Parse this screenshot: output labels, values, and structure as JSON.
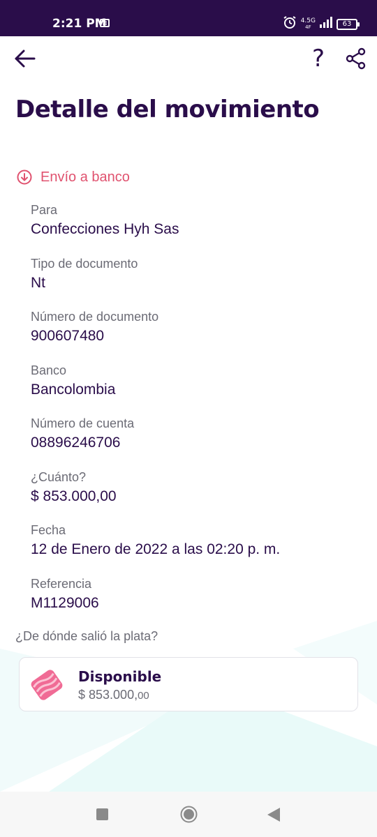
{
  "status_bar": {
    "time": "2:21 PM",
    "network_top": "4.5G",
    "network_bottom": "4F",
    "battery": "63"
  },
  "header": {
    "help_label": "?",
    "title": "Detalle del movimiento"
  },
  "movement": {
    "type": "Envío a banco",
    "fields": [
      {
        "label": "Para",
        "value": "Confecciones Hyh Sas"
      },
      {
        "label": "Tipo de documento",
        "value": "Nt"
      },
      {
        "label": "Número de documento",
        "value": "900607480"
      },
      {
        "label": "Banco",
        "value": "Bancolombia"
      },
      {
        "label": "Número de cuenta",
        "value": "08896246706"
      },
      {
        "label": "¿Cuánto?",
        "value": "$ 853.000,00"
      },
      {
        "label": "Fecha",
        "value": "12 de Enero de 2022 a las 02:20 p. m."
      },
      {
        "label": "Referencia",
        "value": "M1129006"
      }
    ]
  },
  "source": {
    "question": "¿De dónde salió la plata?",
    "account_name": "Disponible",
    "amount_main": "$ 853.000,",
    "amount_cents": "00"
  },
  "colors": {
    "primary": "#2a0d4a",
    "accent": "#e0526f",
    "muted": "#6b6b75",
    "decor": "#eafaf9"
  },
  "icons": {
    "back": "arrow-left-icon",
    "help": "question-icon",
    "share": "share-icon",
    "type": "arrow-down-circle-icon",
    "account": "pink-pocket-icon",
    "nav_recent": "square-icon",
    "nav_home": "circle-icon",
    "nav_back": "triangle-back-icon"
  }
}
